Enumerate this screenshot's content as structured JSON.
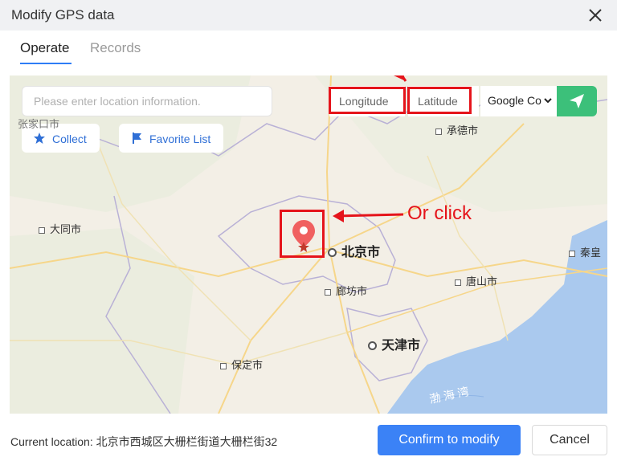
{
  "dialog": {
    "title": "Modify GPS data"
  },
  "tabs": [
    {
      "label": "Operate"
    },
    {
      "label": "Records"
    }
  ],
  "toolbar": {
    "search_placeholder": "Please enter location information.",
    "longitude_placeholder": "Longitude",
    "latitude_placeholder": "Latitude",
    "map_provider": "Google Co",
    "collect_label": "Collect",
    "favorite_label": "Favorite List"
  },
  "map": {
    "annotation": "Or click",
    "cities": {
      "beijing": "北京市",
      "tianjin": "天津市",
      "datong": "大同市",
      "chengde": "承德市",
      "langfang": "廊坊市",
      "tangshan": "唐山市",
      "baoding": "保定市",
      "qinhuang": "秦皇",
      "zhangjiakou": "张家口市",
      "bohai": "渤 海 湾"
    }
  },
  "footer": {
    "current_location_label": "Current location: ",
    "current_location_value": "北京市西城区大栅栏街道大栅栏街32",
    "confirm_label": "Confirm to modify",
    "cancel_label": "Cancel"
  },
  "colors": {
    "accent": "#3b82f6",
    "send": "#3cc07a",
    "highlight": "#e5141b",
    "sea": "#aac9ee",
    "land": "#f3efe6"
  }
}
